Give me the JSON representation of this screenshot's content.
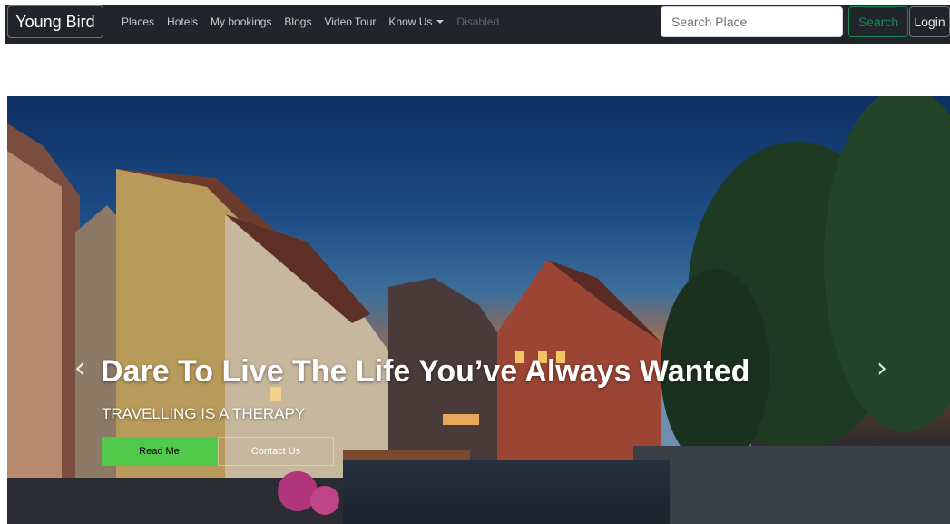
{
  "navbar": {
    "brand": "Young Bird",
    "links": [
      "Places",
      "Hotels",
      "My bookings",
      "Blogs",
      "Video Tour"
    ],
    "dropdown_label": "Know Us",
    "disabled_label": "Disabled",
    "search_placeholder": "Search Place",
    "search_button": "Search",
    "login_button": "Login"
  },
  "hero": {
    "title": "Dare To Live The Life You’ve Always Wanted",
    "subtitle": "TRAVELLING IS A THERAPY",
    "primary_button": "Read Me",
    "secondary_button": "Contact Us",
    "prev_icon": "chevron-left-icon",
    "next_icon": "chevron-right-icon"
  },
  "colors": {
    "navbar_bg": "#212529",
    "search_button": "#198754",
    "read_button": "#52c84a"
  }
}
